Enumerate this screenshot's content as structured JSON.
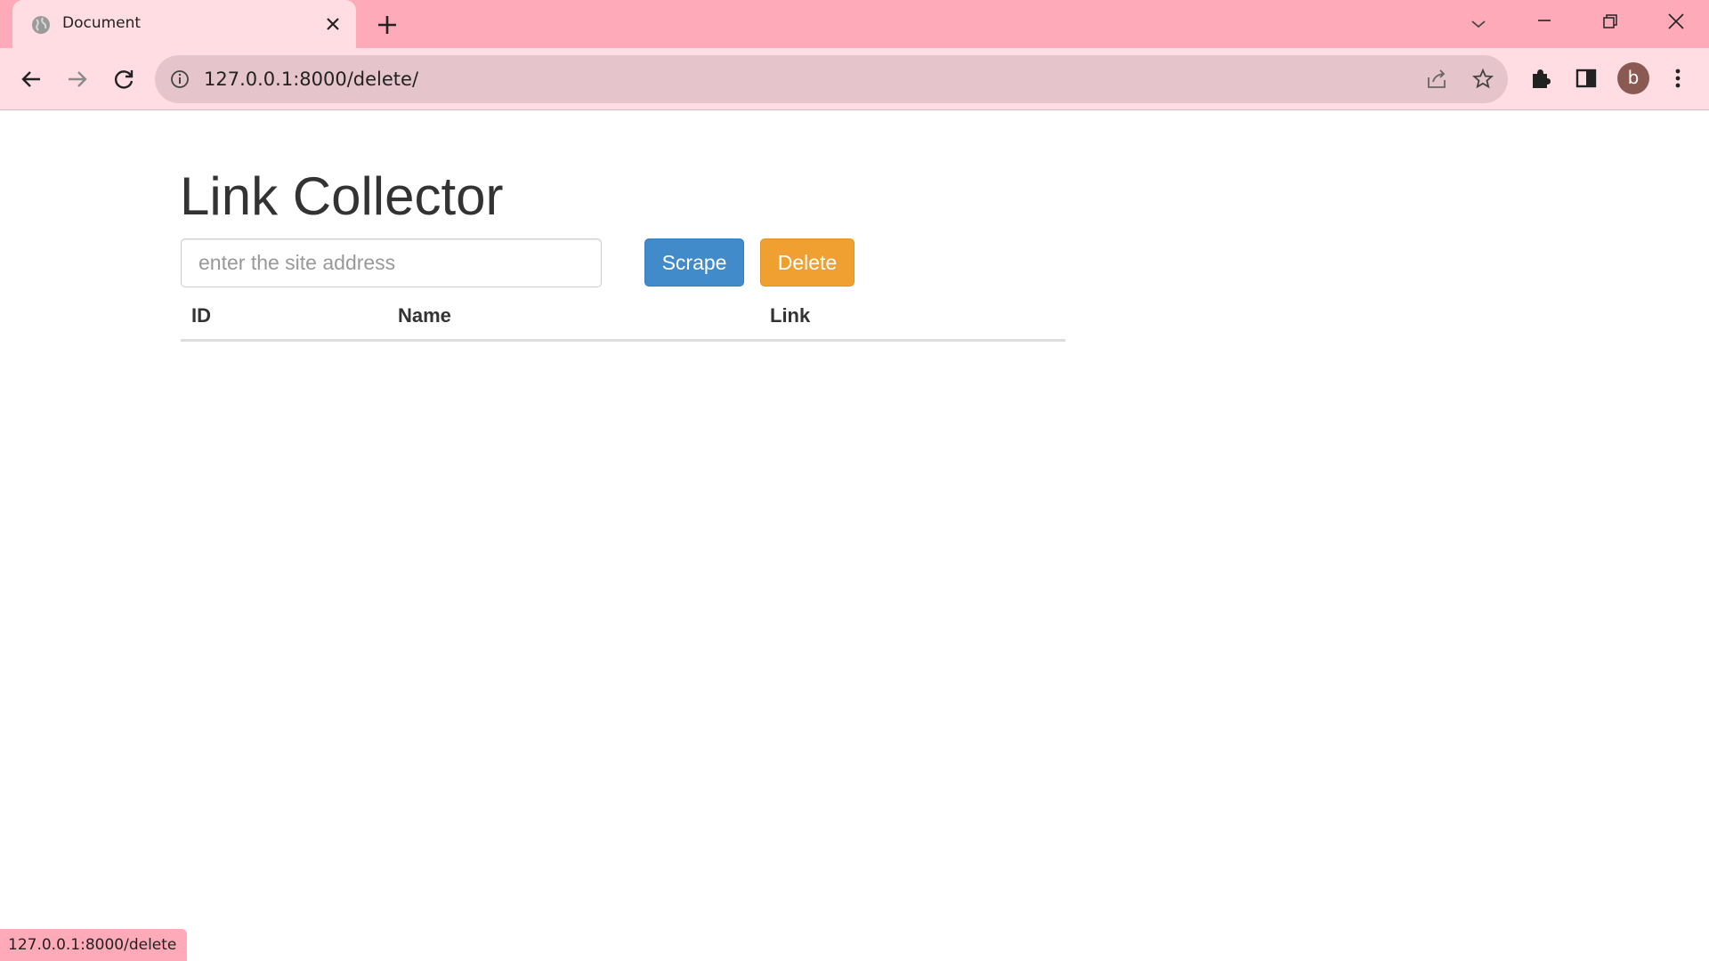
{
  "browser": {
    "tab": {
      "title": "Document",
      "favicon": "globe-icon"
    },
    "address_bar": {
      "url": "127.0.0.1:8000/delete/"
    },
    "profile_initial": "b",
    "status_bar_url": "127.0.0.1:8000/delete",
    "colors": {
      "tabstrip": "#ffaab8",
      "toolbar": "#ffdde3",
      "omnibox": "#e6c4cb"
    }
  },
  "page": {
    "title": "Link Collector",
    "search": {
      "placeholder": "enter the site address",
      "value": ""
    },
    "buttons": {
      "scrape": "Scrape",
      "delete": "Delete"
    },
    "table": {
      "columns": [
        "ID",
        "Name",
        "Link"
      ],
      "rows": []
    },
    "colors": {
      "scrape_button": "#428bca",
      "delete_button": "#f0a030"
    }
  }
}
